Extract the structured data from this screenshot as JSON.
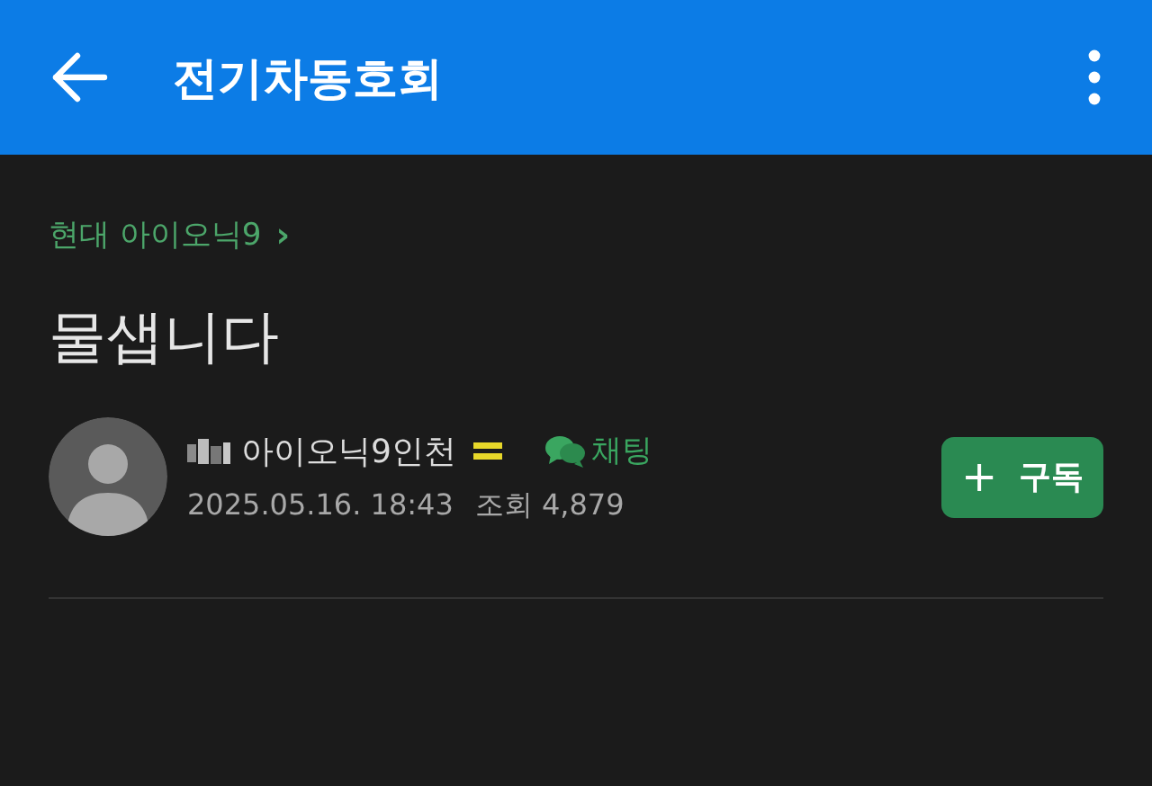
{
  "app_bar": {
    "title": "전기차동호회"
  },
  "post": {
    "board": "현대 아이오닉9",
    "board_arrow": "›",
    "title": "물샙니다",
    "author": {
      "name": "아이오닉9인천",
      "chat": "채팅",
      "date": "2025.05.16. 18:43",
      "views": "조회 4,879"
    },
    "subscribe": {
      "icon": "+",
      "label": "구독"
    }
  }
}
